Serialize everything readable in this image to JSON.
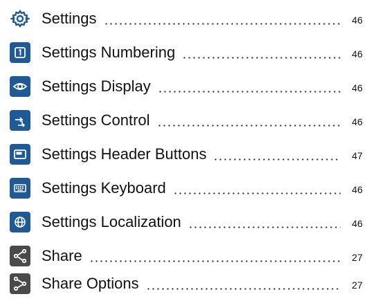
{
  "entries": [
    {
      "label": "Settings",
      "page": "46",
      "icon": "gear-icon"
    },
    {
      "label": "Settings Numbering",
      "page": "46",
      "icon": "numbering-icon"
    },
    {
      "label": "Settings Display",
      "page": "46",
      "icon": "eye-icon"
    },
    {
      "label": "Settings Control",
      "page": "46",
      "icon": "control-arrows-icon"
    },
    {
      "label": "Settings Header Buttons",
      "page": "47",
      "icon": "header-buttons-icon"
    },
    {
      "label": "Settings Keyboard",
      "page": "46",
      "icon": "keyboard-icon"
    },
    {
      "label": "Settings Localization",
      "page": "46",
      "icon": "globe-icon"
    },
    {
      "label": "Share",
      "page": "27",
      "icon": "share-icon"
    },
    {
      "label": "Share Options",
      "page": "27",
      "icon": "share-options-icon"
    }
  ],
  "colors": {
    "icon_blue": "#1f5a96",
    "icon_gray": "#4a4a4a",
    "text": "#111111"
  }
}
